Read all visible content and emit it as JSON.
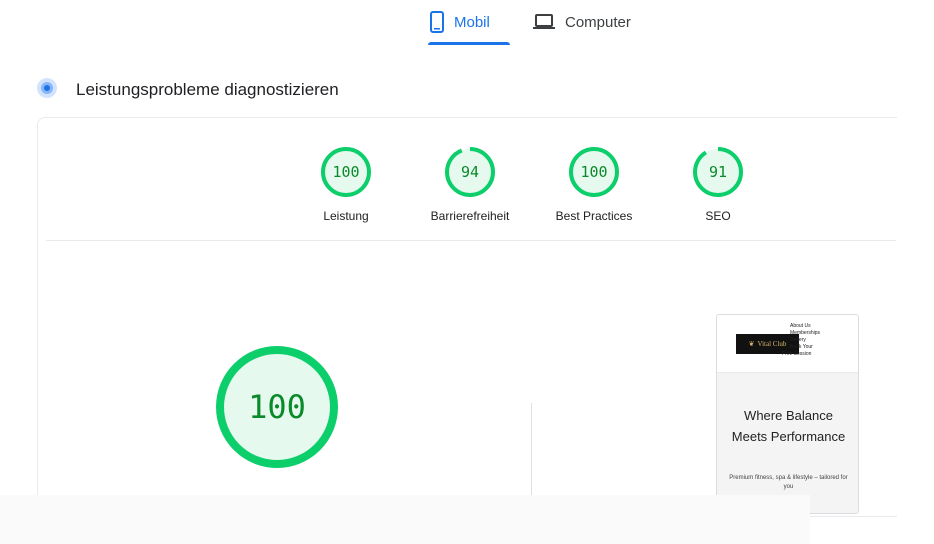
{
  "device_tabs": {
    "mobile_label": "Mobil",
    "desktop_label": "Computer",
    "active": "Mobil",
    "accent_color": "#1a73e8"
  },
  "section": {
    "title": "Leistungsprobleme diagnostizieren",
    "icon": "diagnostics-icon"
  },
  "categories": [
    {
      "label": "Leistung",
      "score": "100",
      "value": 100
    },
    {
      "label": "Barrierefreiheit",
      "score": "94",
      "value": 94
    },
    {
      "label": "Best Practices",
      "score": "100",
      "value": 100
    },
    {
      "label": "SEO",
      "score": "91",
      "value": 91
    }
  ],
  "main_score": {
    "score": "100",
    "value": 100
  },
  "colors": {
    "pass_ring": "#0cce6b",
    "pass_fill": "#e6f9ee",
    "pass_text": "#0a8a2a"
  },
  "screenshot": {
    "logo_text": "Vital Club",
    "nav": [
      "About Us",
      "Memberships",
      "Gallery",
      "Book Your",
      "Free Session"
    ],
    "heading": "Where Balance Meets Performance",
    "subtext": "Premium fitness, spa & lifestyle – tailored for you"
  }
}
